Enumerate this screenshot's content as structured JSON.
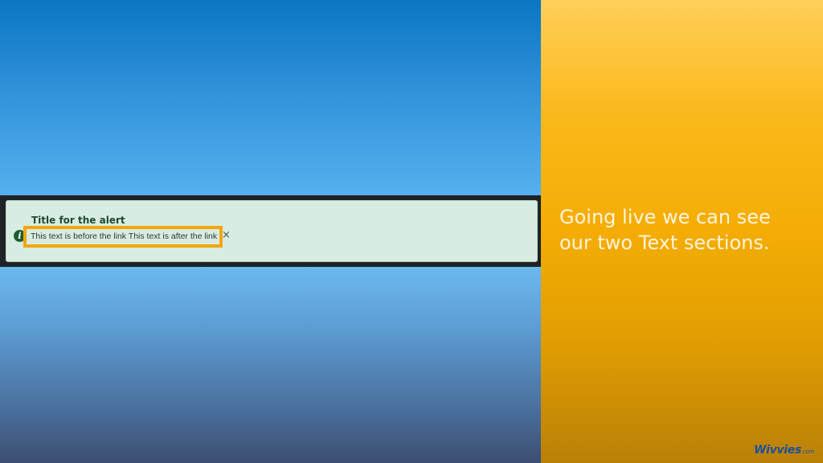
{
  "slide": {
    "caption": "Going live we can see our two Text sections."
  },
  "alert": {
    "icon": "info-icon",
    "icon_glyph": "i",
    "title": "Title for the alert",
    "text_before_link": "This text is before the link",
    "text_after_link": "This text is after the link",
    "close_glyph": "×",
    "highlight_color": "#f3a60d",
    "background_color": "#d9ece2"
  },
  "branding": {
    "logo_text": "Wivvies",
    "logo_suffix": ".com"
  },
  "colors": {
    "accent_panel": "#f4ad05",
    "background_top": "#0a76c4",
    "background_bottom": "#3d4e72"
  }
}
